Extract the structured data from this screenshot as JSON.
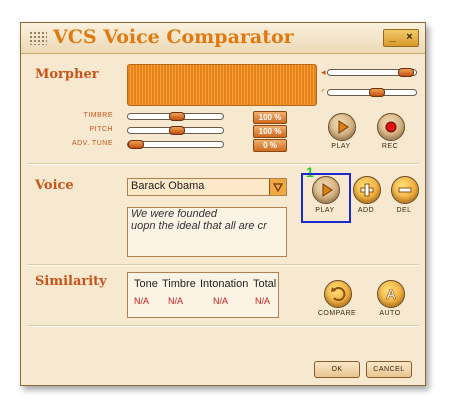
{
  "window": {
    "title_prefix": "VCS",
    "title_rest": "Voice Comparator",
    "minimize": "_",
    "close": "×"
  },
  "morpher": {
    "label": "Morpher",
    "sliders": [
      {
        "name": "TIMBRE",
        "value": "100 %",
        "level": 0.5
      },
      {
        "name": "PITCH",
        "value": "100 %",
        "level": 0.5
      },
      {
        "name": "ADV. TUNE",
        "value": "0 %",
        "level": 0.0
      }
    ],
    "volume_level": 0.95,
    "mic_level": 0.55,
    "play_label": "PLAY",
    "rec_label": "REC"
  },
  "voice": {
    "label": "Voice",
    "selected": "Barack Obama",
    "text_lines": [
      "We were founded",
      "uopn the ideal that all are cr"
    ],
    "play_label": "PLAY",
    "add_label": "ADD",
    "del_label": "DEL",
    "step_marker": "1"
  },
  "similarity": {
    "label": "Similarity",
    "headers": [
      "Tone",
      "Timbre",
      "Intonation",
      "Total"
    ],
    "values": [
      "N/A",
      "N/A",
      "N/A",
      "N/A"
    ],
    "compare_label": "COMPARE",
    "auto_label": "AUTO"
  },
  "footer": {
    "ok_label": "OK",
    "cancel_label": "CANCEL"
  }
}
